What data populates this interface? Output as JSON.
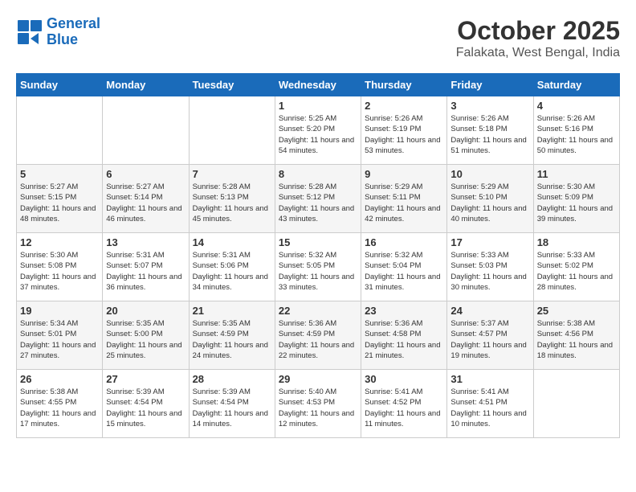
{
  "logo": {
    "line1": "General",
    "line2": "Blue"
  },
  "title": "October 2025",
  "location": "Falakata, West Bengal, India",
  "days_of_week": [
    "Sunday",
    "Monday",
    "Tuesday",
    "Wednesday",
    "Thursday",
    "Friday",
    "Saturday"
  ],
  "weeks": [
    [
      {
        "day": "",
        "info": ""
      },
      {
        "day": "",
        "info": ""
      },
      {
        "day": "",
        "info": ""
      },
      {
        "day": "1",
        "info": "Sunrise: 5:25 AM\nSunset: 5:20 PM\nDaylight: 11 hours\nand 54 minutes."
      },
      {
        "day": "2",
        "info": "Sunrise: 5:26 AM\nSunset: 5:19 PM\nDaylight: 11 hours\nand 53 minutes."
      },
      {
        "day": "3",
        "info": "Sunrise: 5:26 AM\nSunset: 5:18 PM\nDaylight: 11 hours\nand 51 minutes."
      },
      {
        "day": "4",
        "info": "Sunrise: 5:26 AM\nSunset: 5:16 PM\nDaylight: 11 hours\nand 50 minutes."
      }
    ],
    [
      {
        "day": "5",
        "info": "Sunrise: 5:27 AM\nSunset: 5:15 PM\nDaylight: 11 hours\nand 48 minutes."
      },
      {
        "day": "6",
        "info": "Sunrise: 5:27 AM\nSunset: 5:14 PM\nDaylight: 11 hours\nand 46 minutes."
      },
      {
        "day": "7",
        "info": "Sunrise: 5:28 AM\nSunset: 5:13 PM\nDaylight: 11 hours\nand 45 minutes."
      },
      {
        "day": "8",
        "info": "Sunrise: 5:28 AM\nSunset: 5:12 PM\nDaylight: 11 hours\nand 43 minutes."
      },
      {
        "day": "9",
        "info": "Sunrise: 5:29 AM\nSunset: 5:11 PM\nDaylight: 11 hours\nand 42 minutes."
      },
      {
        "day": "10",
        "info": "Sunrise: 5:29 AM\nSunset: 5:10 PM\nDaylight: 11 hours\nand 40 minutes."
      },
      {
        "day": "11",
        "info": "Sunrise: 5:30 AM\nSunset: 5:09 PM\nDaylight: 11 hours\nand 39 minutes."
      }
    ],
    [
      {
        "day": "12",
        "info": "Sunrise: 5:30 AM\nSunset: 5:08 PM\nDaylight: 11 hours\nand 37 minutes."
      },
      {
        "day": "13",
        "info": "Sunrise: 5:31 AM\nSunset: 5:07 PM\nDaylight: 11 hours\nand 36 minutes."
      },
      {
        "day": "14",
        "info": "Sunrise: 5:31 AM\nSunset: 5:06 PM\nDaylight: 11 hours\nand 34 minutes."
      },
      {
        "day": "15",
        "info": "Sunrise: 5:32 AM\nSunset: 5:05 PM\nDaylight: 11 hours\nand 33 minutes."
      },
      {
        "day": "16",
        "info": "Sunrise: 5:32 AM\nSunset: 5:04 PM\nDaylight: 11 hours\nand 31 minutes."
      },
      {
        "day": "17",
        "info": "Sunrise: 5:33 AM\nSunset: 5:03 PM\nDaylight: 11 hours\nand 30 minutes."
      },
      {
        "day": "18",
        "info": "Sunrise: 5:33 AM\nSunset: 5:02 PM\nDaylight: 11 hours\nand 28 minutes."
      }
    ],
    [
      {
        "day": "19",
        "info": "Sunrise: 5:34 AM\nSunset: 5:01 PM\nDaylight: 11 hours\nand 27 minutes."
      },
      {
        "day": "20",
        "info": "Sunrise: 5:35 AM\nSunset: 5:00 PM\nDaylight: 11 hours\nand 25 minutes."
      },
      {
        "day": "21",
        "info": "Sunrise: 5:35 AM\nSunset: 4:59 PM\nDaylight: 11 hours\nand 24 minutes."
      },
      {
        "day": "22",
        "info": "Sunrise: 5:36 AM\nSunset: 4:59 PM\nDaylight: 11 hours\nand 22 minutes."
      },
      {
        "day": "23",
        "info": "Sunrise: 5:36 AM\nSunset: 4:58 PM\nDaylight: 11 hours\nand 21 minutes."
      },
      {
        "day": "24",
        "info": "Sunrise: 5:37 AM\nSunset: 4:57 PM\nDaylight: 11 hours\nand 19 minutes."
      },
      {
        "day": "25",
        "info": "Sunrise: 5:38 AM\nSunset: 4:56 PM\nDaylight: 11 hours\nand 18 minutes."
      }
    ],
    [
      {
        "day": "26",
        "info": "Sunrise: 5:38 AM\nSunset: 4:55 PM\nDaylight: 11 hours\nand 17 minutes."
      },
      {
        "day": "27",
        "info": "Sunrise: 5:39 AM\nSunset: 4:54 PM\nDaylight: 11 hours\nand 15 minutes."
      },
      {
        "day": "28",
        "info": "Sunrise: 5:39 AM\nSunset: 4:54 PM\nDaylight: 11 hours\nand 14 minutes."
      },
      {
        "day": "29",
        "info": "Sunrise: 5:40 AM\nSunset: 4:53 PM\nDaylight: 11 hours\nand 12 minutes."
      },
      {
        "day": "30",
        "info": "Sunrise: 5:41 AM\nSunset: 4:52 PM\nDaylight: 11 hours\nand 11 minutes."
      },
      {
        "day": "31",
        "info": "Sunrise: 5:41 AM\nSunset: 4:51 PM\nDaylight: 11 hours\nand 10 minutes."
      },
      {
        "day": "",
        "info": ""
      }
    ]
  ]
}
